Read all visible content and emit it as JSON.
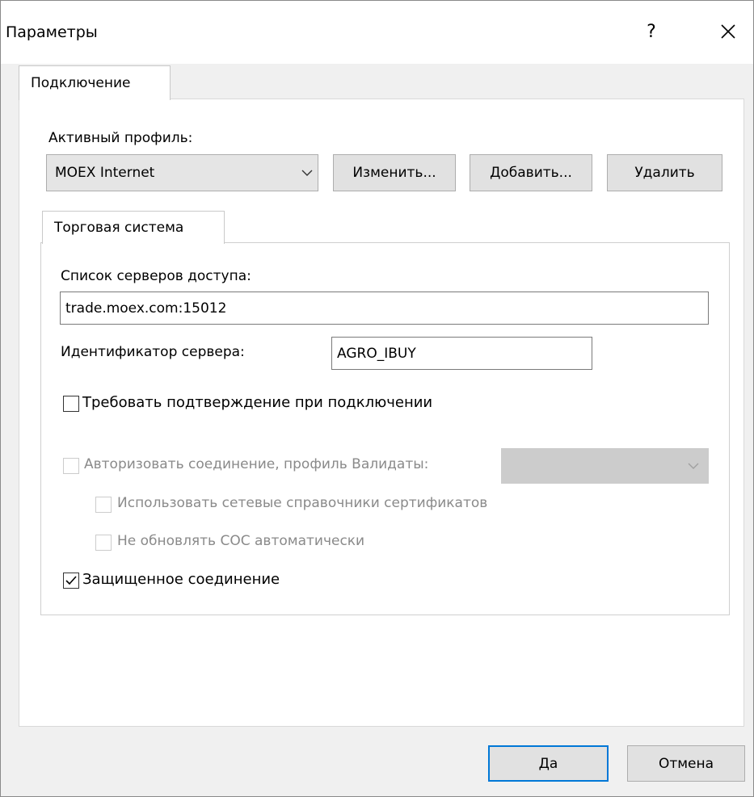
{
  "window": {
    "title": "Параметры",
    "help_label": "?"
  },
  "tabs": {
    "connection": "Подключение",
    "trading_system": "Торговая система"
  },
  "profile": {
    "label": "Активный профиль:",
    "selected": "MOEX Internet",
    "edit_button": "Изменить...",
    "add_button": "Добавить...",
    "delete_button": "Удалить"
  },
  "trading": {
    "servers_label": "Список серверов доступа:",
    "servers_value": "trade.moex.com:15012",
    "server_id_label": "Идентификатор сервера:",
    "server_id_value": "AGRO_IBUY",
    "require_confirm_label": "Требовать подтверждение при подключении",
    "require_confirm_checked": false,
    "authorize_label": "Авторизовать соединение, профиль Валидаты:",
    "authorize_checked": false,
    "authorize_enabled": false,
    "authorize_profile_value": "",
    "net_cert_dirs_label": "Использовать сетевые справочники сертификатов",
    "net_cert_dirs_checked": false,
    "no_auto_update_label": "Не обновлять СОС автоматически",
    "no_auto_update_checked": false,
    "secure_conn_label": "Защищенное соединение",
    "secure_conn_checked": true
  },
  "footer": {
    "ok_button": "Да",
    "cancel_button": "Отмена"
  },
  "icons": {
    "close": "close-icon",
    "chevron": "chevron-down-icon",
    "check": "checkmark-icon"
  },
  "colors": {
    "default_button_border": "#0078d7",
    "dialog_background": "#f0f0f0",
    "panel_background": "#ffffff",
    "disabled_text": "#8a8a8a"
  }
}
